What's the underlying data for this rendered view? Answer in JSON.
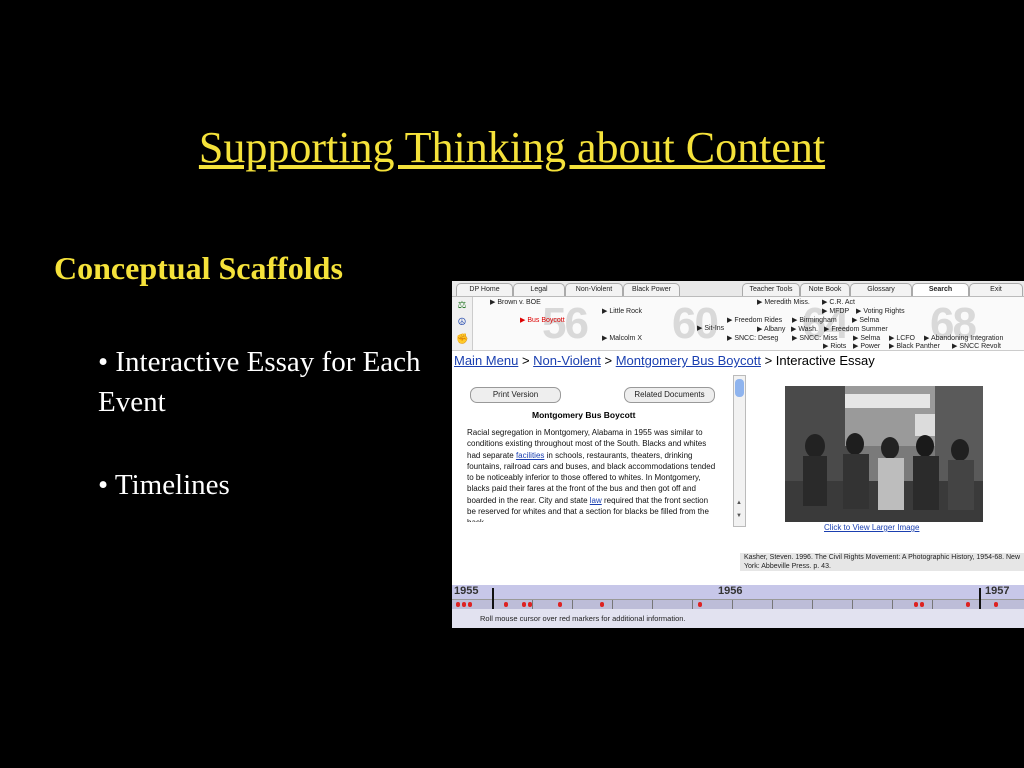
{
  "slide": {
    "title": "Supporting Thinking about Content",
    "heading": "Conceptual Scaffolds",
    "bullets": [
      "•  Interactive Essay for Each Event",
      "• Timelines"
    ]
  },
  "app": {
    "tabs": [
      "DP Home",
      "Legal",
      "Non-Violent",
      "Black Power",
      "Teacher Tools",
      "Note Book",
      "Glossary",
      "Search",
      "Exit"
    ],
    "selected_tab": "Search",
    "timeline_years": [
      "56",
      "60",
      "64",
      "68"
    ],
    "events": {
      "brown": "▶ Brown v. BOE",
      "bus": "▶ Bus Boycott",
      "little_rock": "▶ Little Rock",
      "malcolm": "▶ Malcolm X",
      "sit_ins": "▶ Sit-Ins",
      "freedom_rides": "▶ Freedom Rides",
      "albany": "▶ Albany",
      "sncc_deseg": "▶ SNCC: Deseg",
      "meredith": "▶ Meredith Miss.",
      "birmingham": "▶ Birmingham",
      "wash": "▶ Wash.",
      "sncc_miss": "▶ SNCC: Miss",
      "riots": "▶ Riots",
      "cr_act": "▶ C.R. Act",
      "mfdp": "▶ MFDP",
      "selma1": "▶ Selma",
      "freedom_summer": "▶ Freedom Summer",
      "voting_rights": "▶ Voting Rights",
      "selma2": "▶ Selma",
      "lcfo": "▶ LCFO",
      "power": "▶ Power",
      "black_panther": "▶ Black Panther",
      "abandoning": "▶ Abandoning Integration",
      "sncc_revolt": "▶ SNCC Revolt"
    },
    "breadcrumb": {
      "main": "Main Menu",
      "sep": ">",
      "nonviolent": "Non-Violent",
      "boycott": "Montgomery Bus Boycott",
      "current": "Interactive Essay"
    },
    "print_button": "Print Version",
    "related_button": "Related Documents",
    "essay_title": "Montgomery Bus Boycott",
    "essay_before_link1": "Racial segregation in Montgomery, Alabama in 1955 was similar to conditions existing throughout most of the South. Blacks and whites had separate ",
    "essay_link1": "facilities",
    "essay_after_link1": " in schools, restaurants, theaters, drinking fountains, railroad cars and buses, and black accommodations tended to be noticeably inferior to those offered to whites. In Montgomery, blacks paid their fares at the front of the bus and then got off and boarded in the rear. City and state ",
    "essay_link2": "law",
    "essay_after_link2": " required that the front section be reserved for whites and that a section for blacks be filled from the back.",
    "photo_link": "Click to View Larger Image",
    "citation": "Kasher, Steven. 1996. The Civil Rights Movement: A Photographic History, 1954-68. New York: Abbeville Press. p. 43.",
    "bottom_years": [
      "1955",
      "1956",
      "1957"
    ],
    "note": "Roll mouse cursor over red markers for additional information."
  }
}
